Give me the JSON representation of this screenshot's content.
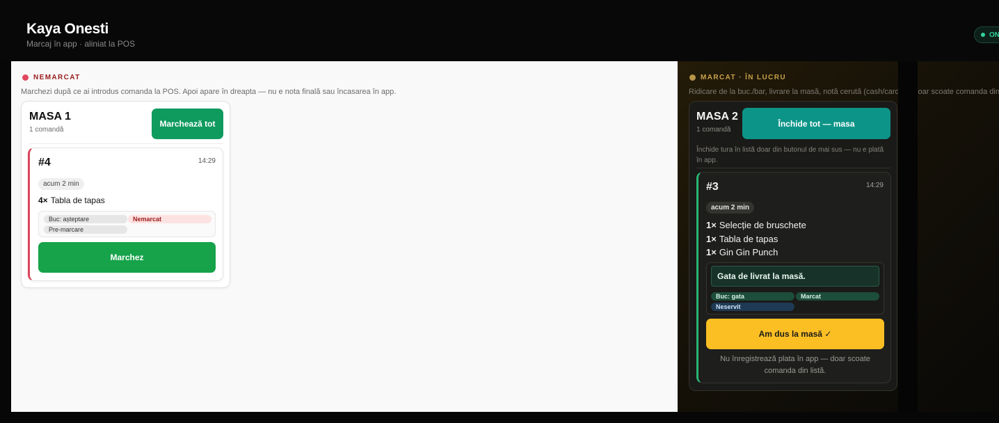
{
  "header": {
    "title": "Kaya Onesti",
    "subtitle": "Marcaj în app · aliniat la POS",
    "status_label": "ON"
  },
  "columns": {
    "unmarked": {
      "label": "NEMARCAT",
      "description": "Marchezi după ce ai introdus comanda la POS. Apoi apare în dreapta — nu e nota finală sau încasarea în app."
    },
    "marked": {
      "label": "MARCAT · ÎN LUCRU",
      "description": "Ridicare de la buc./bar, livrare la masă, notă cerută (cash/card) — doar scoate comanda din listă."
    }
  },
  "tables": [
    {
      "name": "MASA 1",
      "count": "1 comandă",
      "action_label": "Marchează tot",
      "orders": [
        {
          "number": "#4",
          "time": "14:29",
          "age": "acum 2 min",
          "items": [
            {
              "qty": "4×",
              "name": "Tabla de tapas"
            }
          ],
          "chips": [
            "Buc: așteptare",
            "Nemarcat",
            "Pre-marcare"
          ],
          "action_label": "Marchez"
        }
      ]
    },
    {
      "name": "MASA 2",
      "count": "1 comandă",
      "action_label": "Închide tot — masa",
      "note": "Închide tura în listă doar din butonul de mai sus — nu e plată în app.",
      "orders": [
        {
          "number": "#3",
          "time": "14:29",
          "age": "acum 2 min",
          "items": [
            {
              "qty": "1×",
              "name": "Selecție de bruschete"
            },
            {
              "qty": "1×",
              "name": "Tabla de tapas"
            },
            {
              "qty": "1×",
              "name": "Gin Gin Punch"
            }
          ],
          "ready_text": "Gata de livrat la masă.",
          "chips": [
            "Buc: gata",
            "Marcat",
            "Neservit"
          ],
          "action_label": "Am dus la masă ✓",
          "footer": "Nu înregistrează plata în app — doar scoate comanda din listă."
        }
      ]
    }
  ]
}
